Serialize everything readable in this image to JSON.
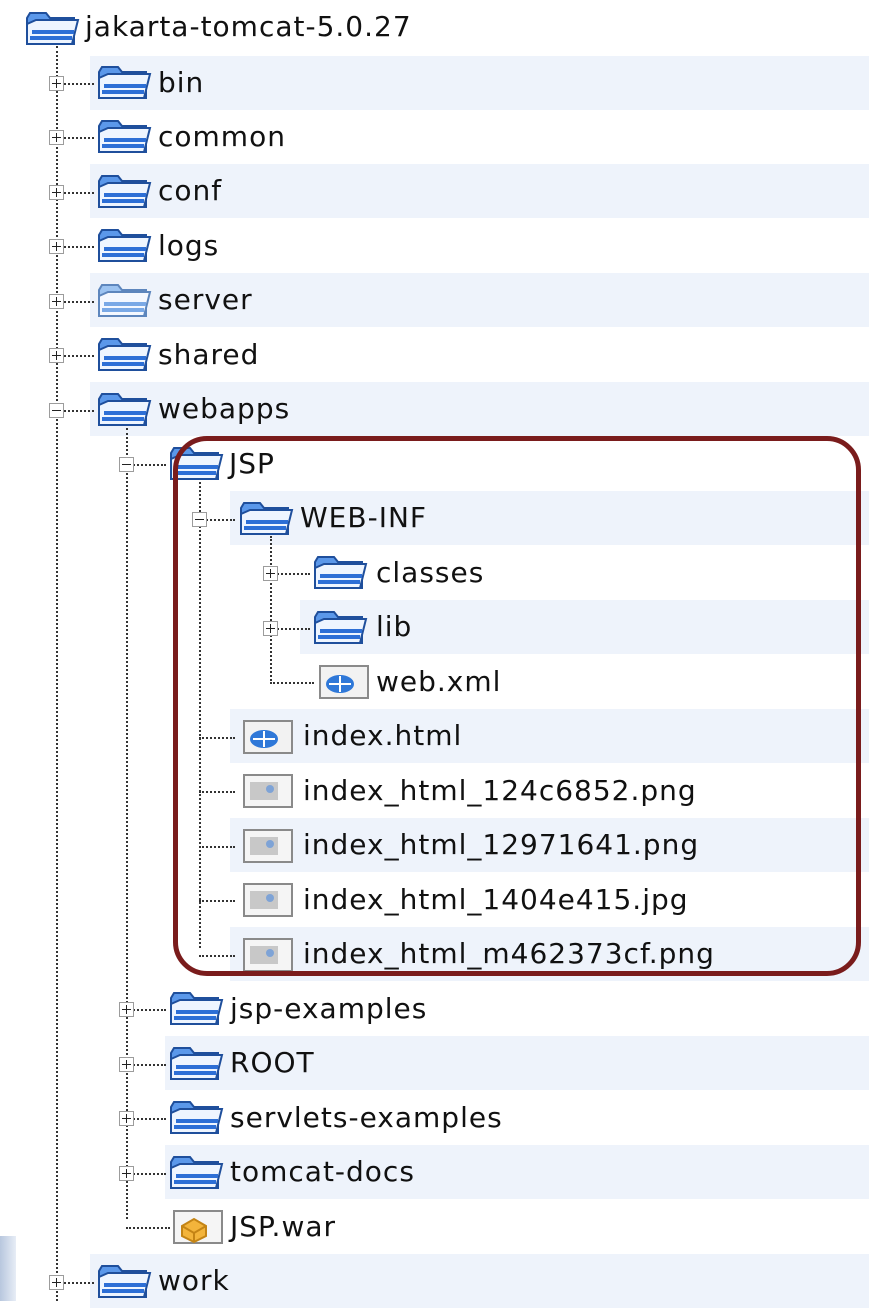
{
  "tree": {
    "root": "jakarta-tomcat-5.0.27",
    "bin": "bin",
    "common": "common",
    "conf": "conf",
    "logs": "logs",
    "server": "server",
    "shared": "shared",
    "webapps": "webapps",
    "jsp": "JSP",
    "web_inf": "WEB-INF",
    "classes": "classes",
    "lib": "lib",
    "web_xml": "web.xml",
    "index_html": "index.html",
    "png1": "index_html_124c6852.png",
    "png2": "index_html_12971641.png",
    "jpg1": "index_html_1404e415.jpg",
    "png3": "index_html_m462373cf.png",
    "jsp_examples": "jsp-examples",
    "root_app": "ROOT",
    "servlets_examples": "servlets-examples",
    "tomcat_docs": "tomcat-docs",
    "jsp_war": "JSP.war",
    "work": "work"
  },
  "icons": {
    "folder": "folder-icon",
    "xml_file": "xml-file-icon",
    "html_file": "html-file-icon",
    "image_file": "image-file-icon",
    "war_file": "war-archive-icon"
  },
  "colors": {
    "folder_blue": "#2d6fd6",
    "row_stripe": "#eef3fb",
    "highlight_border": "#7a1c1c"
  }
}
